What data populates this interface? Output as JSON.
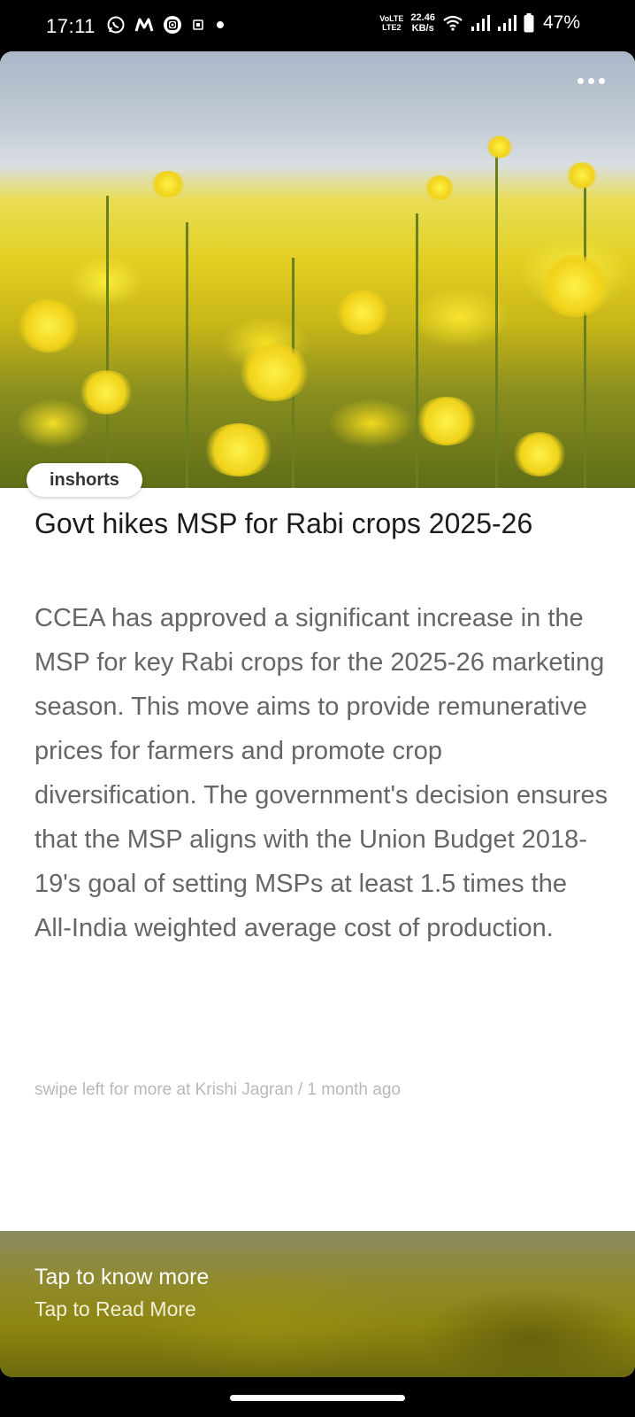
{
  "status_bar": {
    "time": "17:11",
    "left_icons": [
      "whatsapp-icon",
      "m-app-icon",
      "instagram-icon",
      "sim-icon",
      "notification-dot-icon"
    ],
    "volte_line1": "VoLTE",
    "volte_line2": "LTE2",
    "speed_value": "22.46",
    "speed_unit": "KB/s",
    "battery_percent": "47%"
  },
  "card": {
    "brand": "inshorts",
    "headline": "Govt hikes MSP for Rabi crops 2025-26",
    "body": "CCEA has approved a significant increase in the MSP for key Rabi crops for the 2025-26 marketing season. This move aims to provide remunerative prices for farmers and promote crop diversification. The government's decision ensures that the MSP aligns with the Union Budget 2018-19's goal of setting MSPs at least 1.5 times the All-India weighted average cost of production.",
    "source_line": "swipe left for more at Krishi Jagran / 1 month ago"
  },
  "footer": {
    "title": "Tap to know more",
    "subtitle": "Tap to Read More"
  },
  "colors": {
    "headline": "#1b1b1b",
    "body": "#666666",
    "source": "#b8b8b8",
    "footer_bg": "#8e8510"
  }
}
